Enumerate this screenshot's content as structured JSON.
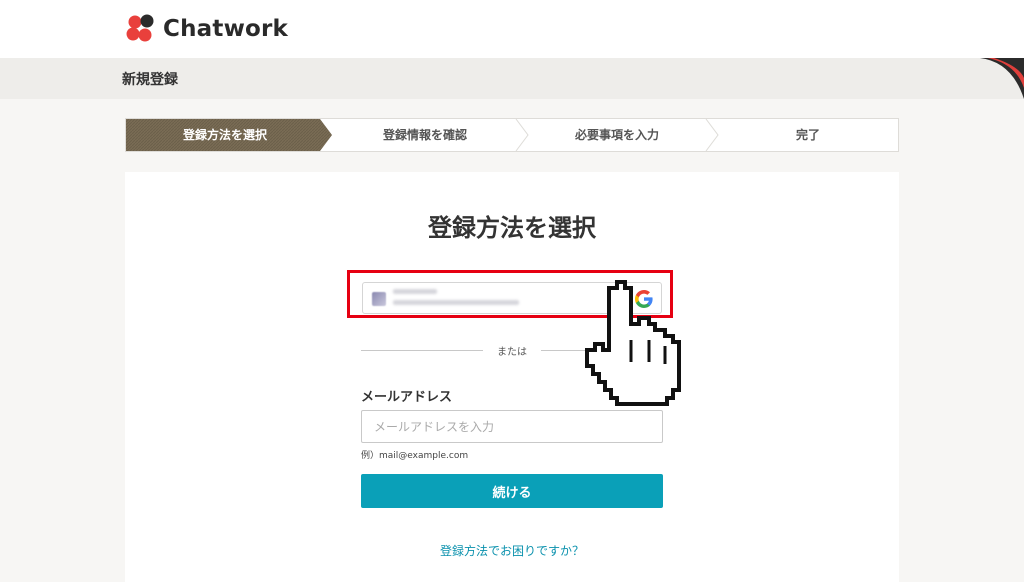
{
  "header": {
    "logo_text": "Chatwork",
    "logo_colors": [
      "#e9403c",
      "#e9403c",
      "#e9403c",
      "#2b2b2b"
    ]
  },
  "title_bar": {
    "label": "新規登録"
  },
  "stepper": {
    "steps": [
      {
        "label": "登録方法を選択",
        "active": true
      },
      {
        "label": "登録情報を確認",
        "active": false
      },
      {
        "label": "必要事項を入力",
        "active": false
      },
      {
        "label": "完了",
        "active": false
      }
    ]
  },
  "main": {
    "title": "登録方法を選択",
    "google_button": {
      "icon": "google-icon"
    },
    "divider_text": "または",
    "email": {
      "label": "メールアドレス",
      "placeholder": "メールアドレスを入力",
      "value": "",
      "hint": "例）mail@example.com"
    },
    "continue_label": "続ける",
    "help_link": "登録方法でお困りですか？"
  },
  "colors": {
    "accent": "#0aa0b8",
    "highlight": "#e60012",
    "active_step": "#7a6c55",
    "link": "#0a91ad"
  }
}
